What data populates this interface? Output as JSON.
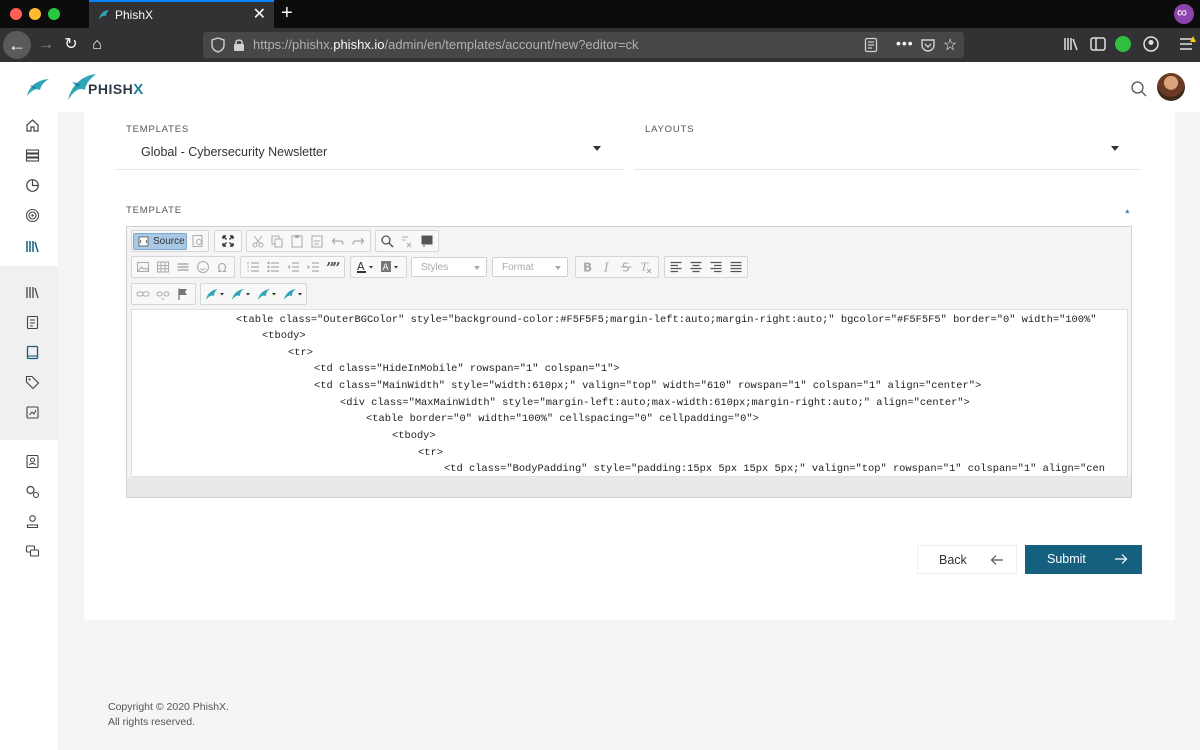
{
  "browser": {
    "tab_title": "PhishX",
    "url_prefix": "https://phishx.",
    "url_domain": "phishx.io",
    "url_path": "/admin/en/templates/account/new?editor=ck"
  },
  "header": {
    "brand_name": "PHISH",
    "brand_x": "X"
  },
  "sidebar": {
    "icons": [
      "home-icon",
      "list-icon",
      "chart-icon",
      "target-icon",
      "library-icon",
      "library-icon",
      "document-icon",
      "book-icon",
      "tag-icon",
      "report-icon",
      "user-card-icon",
      "settings-icon",
      "user-icon",
      "chat-icon"
    ]
  },
  "form": {
    "templates_label": "TEMPLATES",
    "templates_value": "Global - Cybersecurity Newsletter",
    "layouts_label": "LAYOUTS",
    "layouts_value": "",
    "template_label": "TEMPLATE",
    "required_mark": "*"
  },
  "editor": {
    "source_label": "Source",
    "styles_placeholder": "Styles",
    "format_placeholder": "Format",
    "code_lines": [
      "<table class=\"OuterBGColor\" style=\"background-color:#F5F5F5;margin-left:auto;margin-right:auto;\" bgcolor=\"#F5F5F5\" border=\"0\" width=\"100%\"",
      "<tbody>",
      "<tr>",
      "<td class=\"HideInMobile\" rowspan=\"1\" colspan=\"1\">",
      "<td class=\"MainWidth\" style=\"width:610px;\" valign=\"top\" width=\"610\" rowspan=\"1\" colspan=\"1\" align=\"center\">",
      "<div class=\"MaxMainWidth\" style=\"margin-left:auto;max-width:610px;margin-right:auto;\" align=\"center\">",
      "<table border=\"0\" width=\"100%\" cellspacing=\"0\" cellpadding=\"0\">",
      "<tbody>",
      "<tr>",
      "<td class=\"BodyPadding\" style=\"padding:15px 5px 15px 5px;\" valign=\"top\" rowspan=\"1\" colspan=\"1\" align=\"cen"
    ]
  },
  "actions": {
    "back_label": "Back",
    "submit_label": "Submit"
  },
  "footer": {
    "copyright": "Copyright © 2020 PhishX.",
    "rights": "All rights reserved."
  },
  "colors": {
    "primary": "#15607f",
    "accent": "#1d7ea1"
  }
}
